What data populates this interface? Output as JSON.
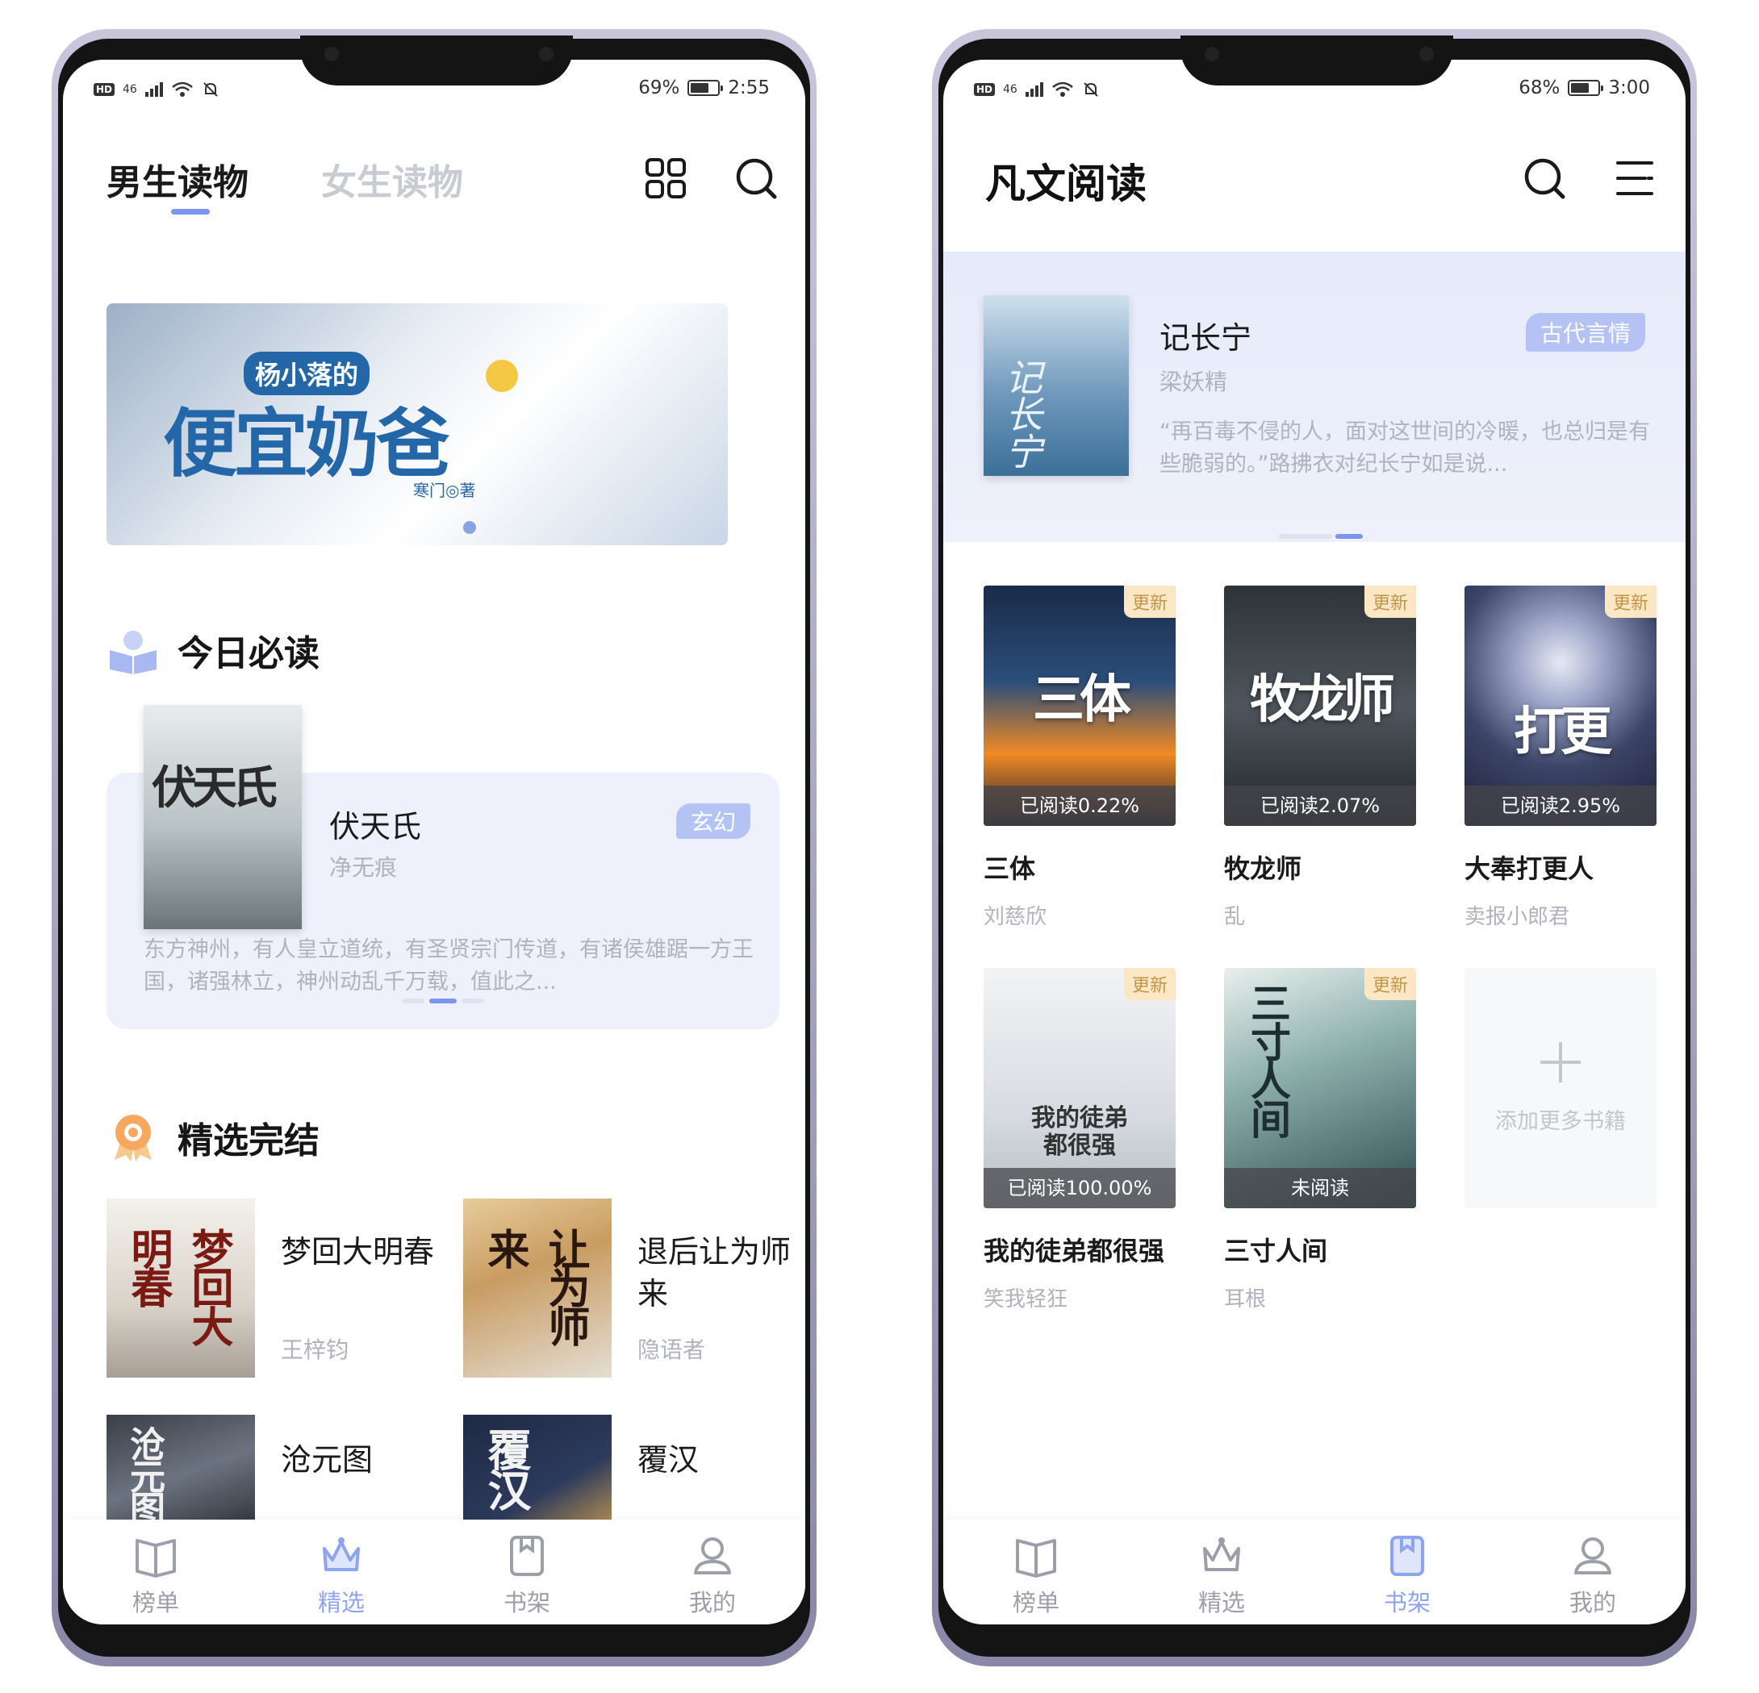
{
  "left_phone": {
    "status": {
      "battery": "69%",
      "time": "2:55",
      "network": "46",
      "hd": "HD",
      "battery_level": 0.69
    },
    "tabs": [
      {
        "label": "男生读物",
        "active": true
      },
      {
        "label": "女生读物",
        "active": false
      }
    ],
    "icons": {
      "grid": "grid-icon",
      "search": "search-icon"
    },
    "banner": {
      "prefix": "杨小落的",
      "title": "便宜奶爸",
      "author": "寒门◎著"
    },
    "today_section": {
      "title": "今日必读"
    },
    "today_book": {
      "title": "伏天氏",
      "author": "净无痕",
      "tag": "玄幻",
      "cover_text": "伏天氏",
      "description": "东方神州，有人皇立道统，有圣贤宗门传道，有诸侯雄踞一方王国，诸强林立，神州动乱千万载，值此之..."
    },
    "finished_section": {
      "title": "精选完结"
    },
    "finished_books": [
      {
        "title": "梦回大明春",
        "author": "王梓钧",
        "cover_text": "梦回大明春"
      },
      {
        "title": "退后让为师来",
        "author": "隐语者",
        "cover_text": "让为师来"
      },
      {
        "title": "沧元图",
        "author": "",
        "cover_text": "沧元图"
      },
      {
        "title": "覆汉",
        "author": "",
        "cover_text": "覆汉"
      }
    ],
    "nav": [
      {
        "label": "榜单",
        "icon": "book-open-icon",
        "active": false
      },
      {
        "label": "精选",
        "icon": "crown-icon",
        "active": true
      },
      {
        "label": "书架",
        "icon": "bookshelf-icon",
        "active": false
      },
      {
        "label": "我的",
        "icon": "user-icon",
        "active": false
      }
    ]
  },
  "right_phone": {
    "status": {
      "battery": "68%",
      "time": "3:00",
      "network": "46",
      "hd": "HD",
      "battery_level": 0.68
    },
    "app_title": "凡文阅读",
    "icons": {
      "search": "search-icon",
      "menu": "menu-icon"
    },
    "recommend": {
      "title": "记长宁",
      "author": "梁妖精",
      "tag": "古代言情",
      "cover_text": "记长宁",
      "description": "“再百毒不侵的人，面对这世间的冷暖，也总归是有些脆弱的。”路拂衣对纪长宁如是说..."
    },
    "shelf": [
      {
        "title": "三体",
        "author": "刘慈欣",
        "badge": "更新",
        "progress": "已阅读0.22%",
        "cover_text": "三体"
      },
      {
        "title": "牧龙师",
        "author": "乱",
        "badge": "更新",
        "progress": "已阅读2.07%",
        "cover_text": "牧龙师"
      },
      {
        "title": "大奉打更人",
        "author": "卖报小郎君",
        "badge": "更新",
        "progress": "已阅读2.95%",
        "cover_text": "打更"
      },
      {
        "title": "我的徒弟都很强",
        "author": "笑我轻狂",
        "badge": "更新",
        "progress": "已阅读100.00%",
        "cover_text": "我的徒弟都很强"
      },
      {
        "title": "三寸人间",
        "author": "耳根",
        "badge": "更新",
        "progress": "未阅读",
        "cover_text": "三寸人间"
      }
    ],
    "add_more": "添加更多书籍",
    "nav": [
      {
        "label": "榜单",
        "icon": "book-open-icon",
        "active": false
      },
      {
        "label": "精选",
        "icon": "crown-icon",
        "active": false
      },
      {
        "label": "书架",
        "icon": "bookshelf-icon",
        "active": true
      },
      {
        "label": "我的",
        "icon": "user-icon",
        "active": false
      }
    ]
  },
  "colors": {
    "accent": "#7d94ef",
    "nav_active": "#8fa4ef",
    "muted_text": "#b0b3bd",
    "tag_bg": "#b4c3f3",
    "badge_bg": "#fbe7c4",
    "card_bg": "#eef1fb"
  }
}
